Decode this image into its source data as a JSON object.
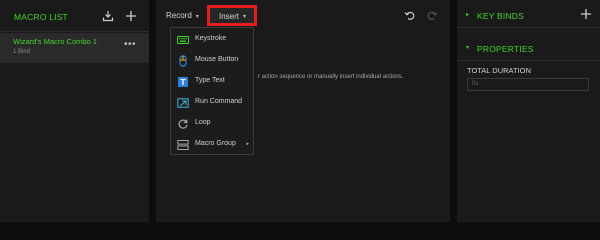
{
  "left_panel": {
    "title": "MACRO LIST",
    "macros": [
      {
        "name": "Wizard's Macro Combo 1",
        "subtitle": "1 Bind",
        "more": "•••"
      }
    ]
  },
  "middle_panel": {
    "record_label": "Record",
    "insert_label": "Insert",
    "caret": "▾",
    "hint_text": "r action sequence or manually insert individual actions.",
    "insert_menu": [
      {
        "label": "Keystroke",
        "icon": "keyboard-icon"
      },
      {
        "label": "Mouse Button",
        "icon": "mouse-icon"
      },
      {
        "label": "Type Text",
        "icon": "text-icon"
      },
      {
        "label": "Run Command",
        "icon": "run-command-icon"
      },
      {
        "label": "Loop",
        "icon": "loop-icon"
      },
      {
        "label": "Macro Group",
        "icon": "macro-group-icon",
        "submenu": "▸"
      }
    ]
  },
  "right_panel": {
    "key_binds_title": "KEY BINDS",
    "properties_title": "PROPERTIES",
    "expand_caret": "▸",
    "collapse_caret": "▾",
    "total_duration_label": "TOTAL DURATION",
    "duration_placeholder": "0s"
  },
  "colors": {
    "accent": "#44d62c",
    "highlight_box": "#e51d1d",
    "panel": "#1a1a1a",
    "background": "#0d0d0d"
  }
}
